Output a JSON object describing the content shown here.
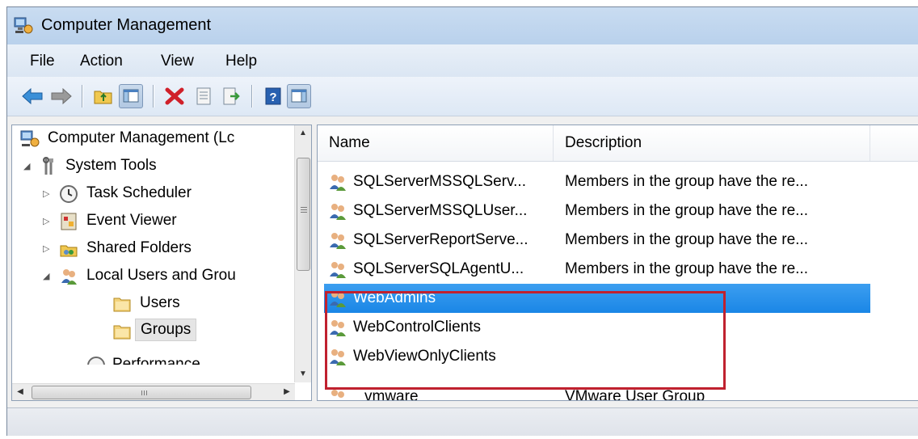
{
  "window": {
    "title": "Computer Management"
  },
  "menu": [
    "File",
    "Action",
    "View",
    "Help"
  ],
  "toolbar": {
    "buttons": [
      "back-arrow-icon",
      "forward-arrow-icon",
      "up-folder-icon",
      "show-hide-tree-icon",
      "delete-icon",
      "properties-icon",
      "export-list-icon",
      "help-icon",
      "show-hide-action-pane-icon"
    ]
  },
  "tree": [
    {
      "label": "Computer Management (Lc",
      "icon": "computer-management-icon"
    },
    {
      "label": "System Tools",
      "icon": "system-tools-icon",
      "expanded": true
    },
    {
      "label": "Task Scheduler",
      "icon": "clock-icon",
      "expanded": false
    },
    {
      "label": "Event Viewer",
      "icon": "event-viewer-icon",
      "expanded": false
    },
    {
      "label": "Shared Folders",
      "icon": "shared-folders-icon",
      "expanded": false
    },
    {
      "label": "Local Users and Grou",
      "icon": "users-groups-icon",
      "expanded": true
    },
    {
      "label": "Users",
      "icon": "folder-icon"
    },
    {
      "label": "Groups",
      "icon": "folder-icon",
      "selected": true
    },
    {
      "label": "Performance",
      "icon": "performance-icon",
      "expanded": false
    }
  ],
  "columns": [
    "Name",
    "Description"
  ],
  "rows": [
    {
      "name": "SQLServerMSSQLServ...",
      "description": "Members in the group have the re..."
    },
    {
      "name": "SQLServerMSSQLUser...",
      "description": "Members in the group have the re..."
    },
    {
      "name": "SQLServerReportServe...",
      "description": "Members in the group have the re..."
    },
    {
      "name": "SQLServerSQLAgentU...",
      "description": "Members in the group have the re..."
    },
    {
      "name": "WebAdmins",
      "description": "",
      "selected": true
    },
    {
      "name": "WebControlClients",
      "description": ""
    },
    {
      "name": "WebViewOnlyClients",
      "description": ""
    },
    {
      "name": "vmware",
      "description": "VMware User Group"
    }
  ],
  "colors": {
    "selection": "#1a86e6",
    "annotation_box": "#c0212f",
    "title_bar": "#c9dcf1"
  }
}
